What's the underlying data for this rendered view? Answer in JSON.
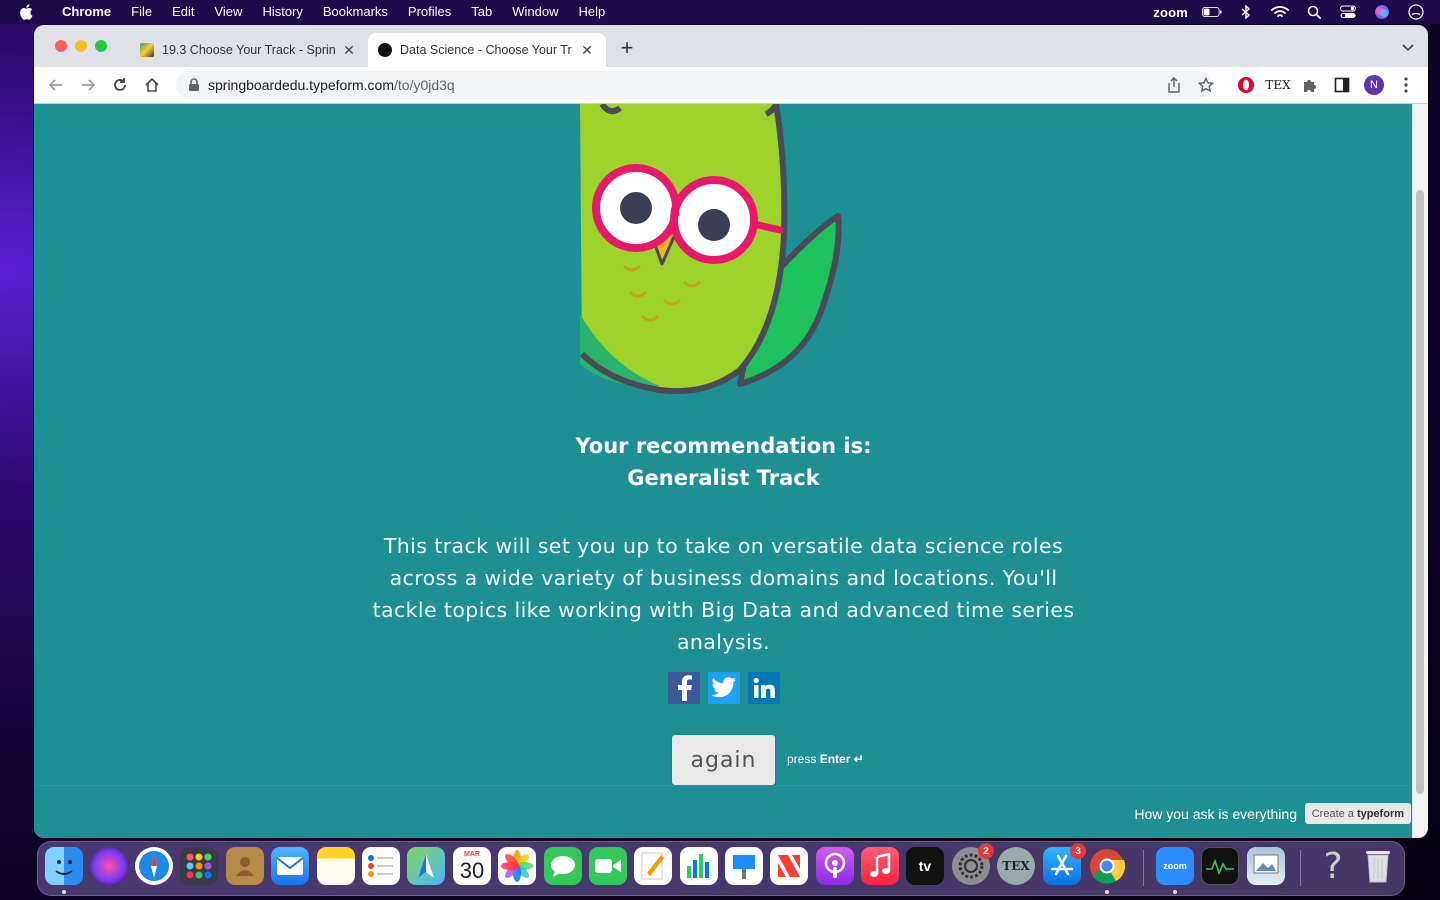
{
  "menubar": {
    "app": "Chrome",
    "items": [
      "File",
      "Edit",
      "View",
      "History",
      "Bookmarks",
      "Profiles",
      "Tab",
      "Window",
      "Help"
    ],
    "zoom_label": "zoom"
  },
  "browser": {
    "tabs": [
      {
        "title": "19.3 Choose Your Track - Sprin"
      },
      {
        "title": "Data Science - Choose Your Tr"
      }
    ],
    "url_host": "springboardedu.typeform.com",
    "url_path": "/to/y0jd3q",
    "avatar_initial": "N"
  },
  "page": {
    "heading_line1": "Your recommendation is:",
    "heading_line2": "Generalist Track",
    "description": "This track will set you up to take on versatile data science roles across a wide variety of business domains and locations. You'll tackle topics like working with Big Data and advanced time series analysis.",
    "social": [
      "facebook-icon",
      "twitter-icon",
      "linkedin-icon"
    ],
    "again_label": "again",
    "press_label": "press",
    "press_key": "Enter ↵",
    "footer_tagline": "How you ask is everything",
    "create_label": "Create a",
    "create_brand": "typeform"
  },
  "dock": {
    "calendar_month": "MAR",
    "calendar_day": "30",
    "settings_badge": "2",
    "appstore_badge": "3",
    "zoom_label": "zoom",
    "tv_label": "tv"
  },
  "colors": {
    "page_bg": "#1e9094",
    "owl_green": "#9ed32b",
    "owl_glasses": "#e8196a"
  }
}
